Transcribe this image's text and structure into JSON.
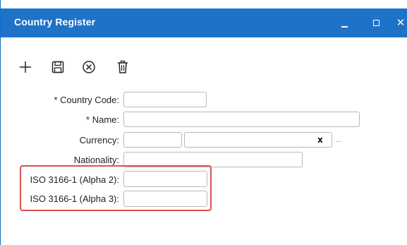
{
  "window": {
    "title": "Country Register",
    "minimize_glyph": "_",
    "maximize_glyph": "□",
    "close_glyph": "✕"
  },
  "toolbar": {
    "items": [
      {
        "name": "add",
        "icon": "plus-icon"
      },
      {
        "name": "save",
        "icon": "save-icon"
      },
      {
        "name": "cancel",
        "icon": "cancel-circle-icon"
      },
      {
        "name": "delete",
        "icon": "trash-icon"
      }
    ]
  },
  "form": {
    "country_code": {
      "label": "* Country Code:",
      "value": ""
    },
    "name": {
      "label": "* Name:",
      "value": ""
    },
    "currency": {
      "label": "Currency:",
      "code_value": "",
      "name_value": "",
      "clear_glyph": "x",
      "more_glyph": "..."
    },
    "nationality": {
      "label": "Nationality:",
      "value": ""
    },
    "iso_alpha2": {
      "label": "ISO 3166-1 (Alpha 2):",
      "value": ""
    },
    "iso_alpha3": {
      "label": "ISO 3166-1 (Alpha 3):",
      "value": ""
    }
  },
  "colors": {
    "titlebar": "#1e73c8",
    "highlight": "#d9534f"
  }
}
